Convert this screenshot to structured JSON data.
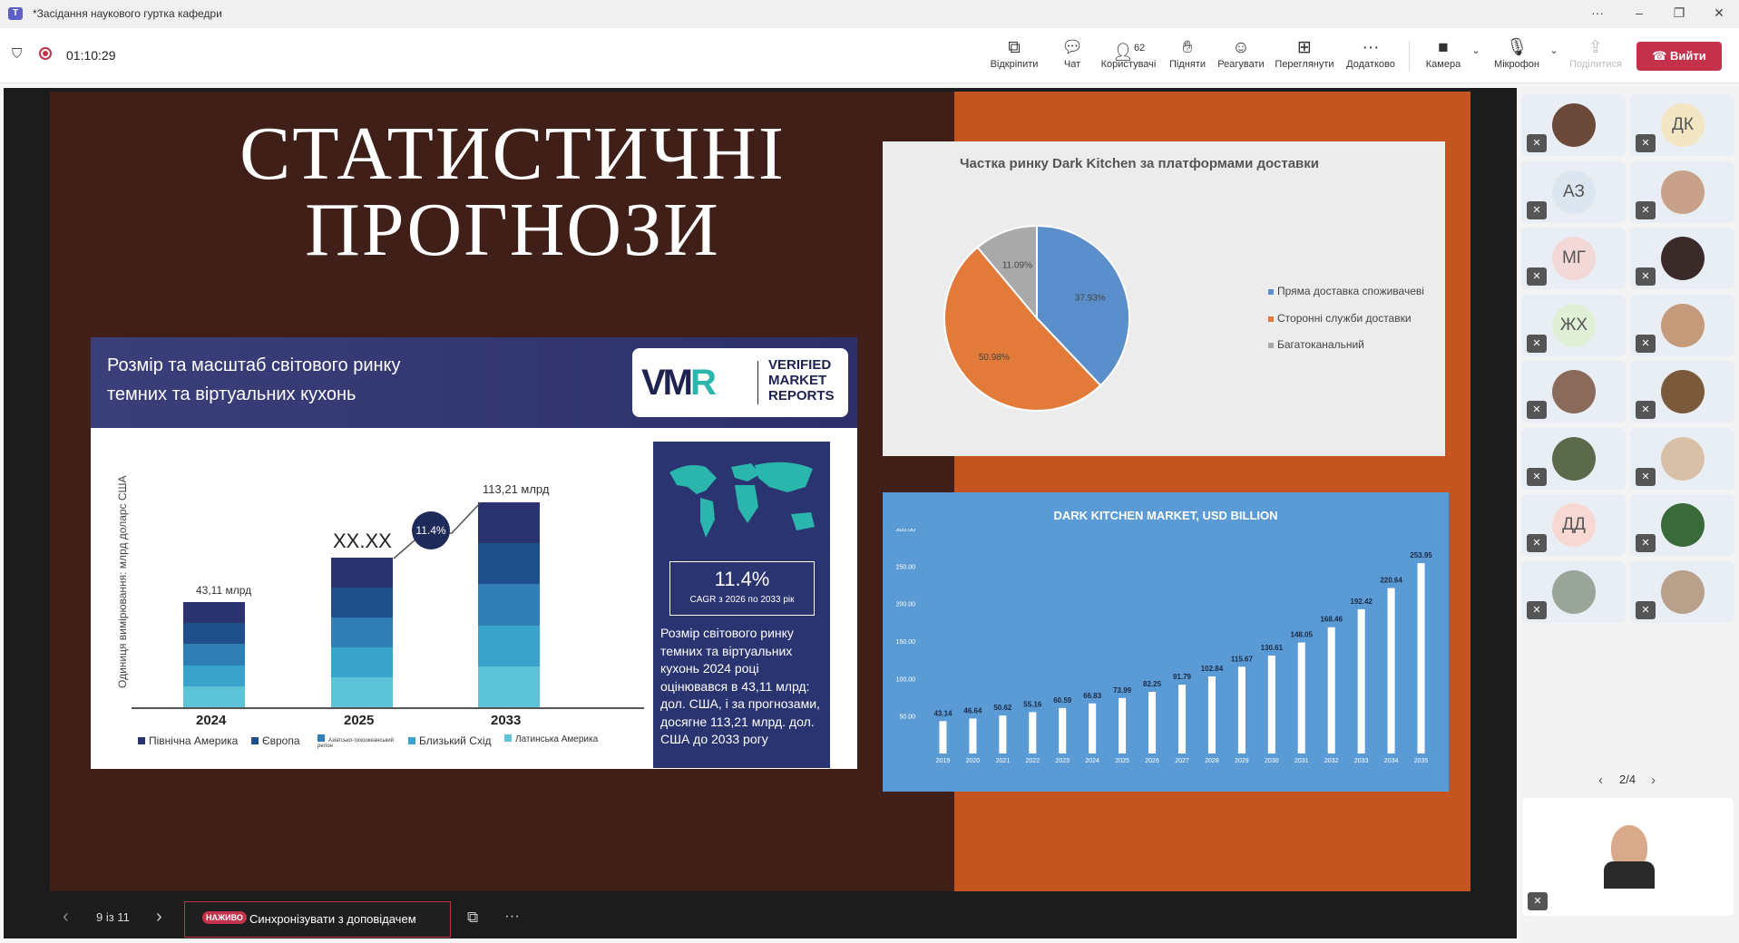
{
  "window": {
    "title": "*Засідання наукового гуртка кафедри"
  },
  "meeting": {
    "timer": "01:10:29"
  },
  "toolbar": {
    "popout": "Відкріпити",
    "chat": "Чат",
    "people_count": "62",
    "people": "Користувачі",
    "raise": "Підняти",
    "react": "Реагувати",
    "view": "Переглянути",
    "more": "Додатково",
    "camera": "Камера",
    "mic": "Мікрофон",
    "share": "Поділитися",
    "leave": "Вийти"
  },
  "slide": {
    "title": "СТАТИСТИЧНІ ПРОГНОЗИ",
    "card1": {
      "heading_line1": "Розмір та масштаб світового ринку",
      "heading_line2": "темних та віртуальних кухонь",
      "brand_line1": "VERIFIED",
      "brand_line2": "MARKET",
      "brand_line3": "REPORTS",
      "y_axis": "Одиниця вимірювання: млрд доларс США",
      "bars": [
        {
          "year": "2024",
          "label": "43,11 млрд"
        },
        {
          "year": "2025",
          "label": "XX.XX"
        },
        {
          "year": "2033",
          "label": "113,21 млрд"
        }
      ],
      "badge": "11.4%",
      "legend": [
        "Північна Америка",
        "Європа",
        "Азіатсько-тихоокеанський регіон",
        "Близький Схід",
        "Латинська Америка"
      ],
      "panel_cagr": "11.4%",
      "panel_cagr_sub": "CAGR з 2026 по 2033 рік",
      "panel_text": "Розмір світового ринку темних та віртуальних кухонь 2024 році оцінювався в 43,11 млрд: дол. США, і за прогнозами, досягне 113,21 млрд. дол. США до 2033 рогу"
    },
    "legend_colors": [
      "#2b3270",
      "#1f4f8a",
      "#2f7fb4",
      "#3aa3cc",
      "#5cc4d6"
    ]
  },
  "chart_data": [
    {
      "type": "pie",
      "title": "Частка ринку Dark Kitchen за платформами доставки",
      "categories": [
        "Пряма доставка споживачеві",
        "Сторонні служби доставки",
        "Багатоканальний"
      ],
      "values": [
        37.93,
        50.98,
        11.09
      ],
      "labels": [
        "37.93%",
        "50.98%",
        "11.09%"
      ],
      "colors": [
        "#5b8fcc",
        "#e27a3a",
        "#a9a9a9"
      ],
      "legend": "right"
    },
    {
      "type": "bar",
      "title": "DARK KITCHEN MARKET, USD BILLION",
      "categories": [
        "2019",
        "2020",
        "2021",
        "2022",
        "2023",
        "2024",
        "2025",
        "2026",
        "2027",
        "2028",
        "2029",
        "2030",
        "2031",
        "2032",
        "2033",
        "2034",
        "2035"
      ],
      "values": [
        43.14,
        46.64,
        50.62,
        55.16,
        60.59,
        66.83,
        73.99,
        82.25,
        91.79,
        102.84,
        115.67,
        130.61,
        148.05,
        168.46,
        192.42,
        220.64,
        253.95
      ],
      "ylim": [
        0,
        300
      ],
      "yticks": [
        "300.00",
        "250.00",
        "200.00",
        "150.00",
        "100.00",
        "50.00"
      ]
    }
  ],
  "presentation": {
    "page": "9 із 11",
    "sync_label": "Синхронізувати з доповідачем",
    "live_badge": "НАЖИВО"
  },
  "roster": {
    "tiles": [
      {
        "initials": "",
        "name": "participant-1"
      },
      {
        "initials": "ДК",
        "color": "#f3e6c4"
      },
      {
        "initials": "АЗ",
        "color": "#dbe6f0"
      },
      {
        "initials": "",
        "name": "participant-4"
      },
      {
        "initials": "МГ",
        "color": "#f3d8d8"
      },
      {
        "initials": "",
        "name": "participant-6"
      },
      {
        "initials": "ЖХ",
        "color": "#dff0d6"
      },
      {
        "initials": "",
        "name": "participant-8"
      },
      {
        "initials": "",
        "name": "participant-9"
      },
      {
        "initials": "",
        "name": "participant-10"
      },
      {
        "initials": "",
        "name": "participant-11"
      },
      {
        "initials": "",
        "name": "participant-12"
      },
      {
        "initials": "ДД",
        "color": "#f7d8d2"
      },
      {
        "initials": "",
        "name": "participant-14"
      },
      {
        "initials": "",
        "name": "participant-15"
      },
      {
        "initials": "",
        "name": "participant-16"
      }
    ],
    "pager": "2/4"
  }
}
